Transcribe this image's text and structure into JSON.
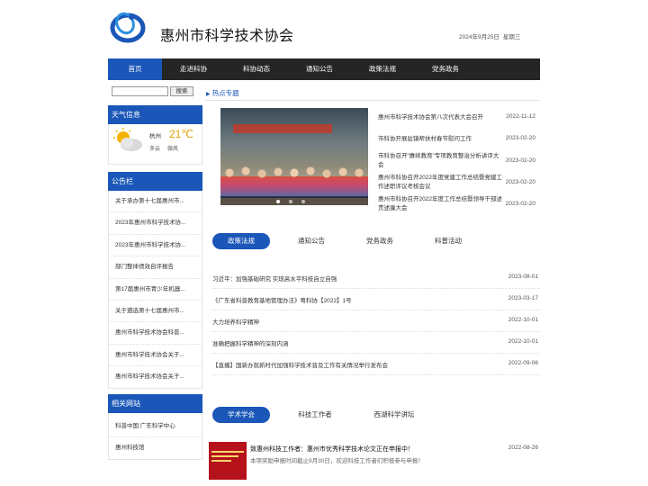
{
  "header": {
    "site_title": "惠州市科学技术协会",
    "date": "2024年9月25日",
    "weekday": "星期三"
  },
  "nav": [
    "首页",
    "走进科协",
    "科协动态",
    "通知公告",
    "政策法规",
    "党务政务"
  ],
  "search": {
    "placeholder": "",
    "button": "搜索"
  },
  "weather": {
    "heading": "天气信息",
    "city": "杭州",
    "temp": "21℃",
    "condition": "多云",
    "wind": "微风"
  },
  "notices": {
    "heading": "公告栏",
    "items": [
      "关于承办第十七届惠州市...",
      "2023年惠州市科学技术协...",
      "2023年惠州市科学技术协...",
      "部门整体绩效自评报告",
      "第17届惠州市青少年机器...",
      "关于遴选第十七届惠州市...",
      "惠州市科学技术协会科普...",
      "惠州市科学技术协会关于...",
      "惠州市科学技术协会关于..."
    ]
  },
  "links": {
    "heading": "相关网站",
    "items": [
      "科普中国   广东科学中心",
      "惠州科技馆"
    ]
  },
  "hot": {
    "heading": "热点专题",
    "items": [
      {
        "title": "惠州市科学技术协会第八次代表大会召开",
        "date": "2022-11-12"
      },
      {
        "title": "市科协开展驻镇帮扶村春节慰问工作",
        "date": "2023-02-20"
      },
      {
        "title": "市科协召开“赓续教育”专项教育整治分析讲评大会",
        "date": "2023-02-20"
      },
      {
        "title": "惠州市科协召开2022年度党建工作总结暨党建工作述职评议考核会议",
        "date": "2023-02-20"
      },
      {
        "title": "惠州市科协召开2022年度工作总结暨领导干部述责述廉大会",
        "date": "2023-02-20"
      }
    ]
  },
  "tabs1": {
    "items": [
      "政策法规",
      "通知公告",
      "党务政务",
      "科普活动"
    ],
    "rows": [
      {
        "title": "习近平：加强基础研究 实现高水平科技自立自强",
        "date": "2023-08-01"
      },
      {
        "title": "《广东省科普教育基地管理办法》粤科协【2022】1号",
        "date": "2023-03-17"
      },
      {
        "title": "大力培养科学精神",
        "date": "2022-10-01"
      },
      {
        "title": "准确把握科学精神的深刻内涵",
        "date": "2022-10-01"
      },
      {
        "title": "【直播】国新办就新时代加强科学技术普及工作有关情况举行发布会",
        "date": "2022-09-06"
      }
    ]
  },
  "tabs2": {
    "items": [
      "学术学会",
      "科技工作者",
      "西湖科学讲坛"
    ]
  },
  "featured": {
    "title": "致惠州科技工作者：惠州市优秀科学技术论文正在申报中！",
    "desc": "本项奖励申报时间截止9月30日，欢迎科技工作者们积极参与申报！",
    "date": "2022-08-26"
  },
  "colors": {
    "accent": "#1a57b8",
    "nav_bg": "#252525"
  }
}
